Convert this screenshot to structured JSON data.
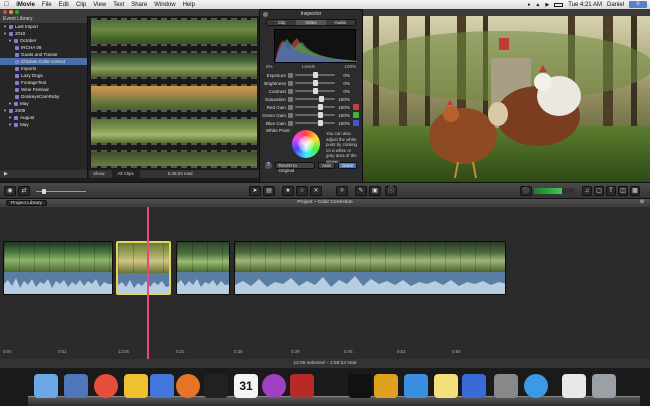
{
  "menubar": {
    "apple": "",
    "app_name": "iMovie",
    "items": [
      "File",
      "Edit",
      "Clip",
      "View",
      "Text",
      "Share",
      "Window",
      "Help"
    ],
    "clock": "Tue 4:21 AM",
    "user": "Daniel"
  },
  "event_library": {
    "header": "Event Library",
    "items": [
      {
        "label": "Last Import",
        "level": 0,
        "selected": false
      },
      {
        "label": "2010",
        "level": 0,
        "selected": false
      },
      {
        "label": "October",
        "level": 1,
        "selected": false
      },
      {
        "label": "IRCHA 08",
        "level": 2,
        "selected": false
      },
      {
        "label": "Goats and Tractor",
        "level": 2,
        "selected": false
      },
      {
        "label": "Chicken Color correct",
        "level": 2,
        "selected": true
      },
      {
        "label": "Imports",
        "level": 2,
        "selected": false
      },
      {
        "label": "Lazy Dogs",
        "level": 2,
        "selected": false
      },
      {
        "label": "FootageText",
        "level": 2,
        "selected": false
      },
      {
        "label": "Wine Festival",
        "level": 2,
        "selected": false
      },
      {
        "label": "DonkeysCamRuby",
        "level": 2,
        "selected": false
      },
      {
        "label": "May",
        "level": 1,
        "selected": false
      },
      {
        "label": "2009",
        "level": 0,
        "selected": false
      },
      {
        "label": "August",
        "level": 1,
        "selected": false
      },
      {
        "label": "May",
        "level": 1,
        "selected": false
      }
    ]
  },
  "event_browser": {
    "show_label": "Show:",
    "show_value": "All Clips",
    "total": "5:36:53 total"
  },
  "inspector": {
    "title": "Inspector",
    "tabs": [
      {
        "label": "Clip",
        "active": false
      },
      {
        "label": "Video",
        "active": true
      },
      {
        "label": "Audio",
        "active": false
      }
    ],
    "levels_label": "Levels",
    "levels_min": "0%",
    "levels_max": "100%",
    "sliders": [
      {
        "label": "Exposure",
        "value": "0%",
        "pos": 0.5
      },
      {
        "label": "Brightness",
        "value": "0%",
        "pos": 0.5
      },
      {
        "label": "Contrast",
        "value": "0%",
        "pos": 0.5
      },
      {
        "label": "Saturation",
        "value": "100%",
        "pos": 0.68
      },
      {
        "label": "Red Gain",
        "value": "100%",
        "pos": 0.65,
        "color": "#d23a3a"
      },
      {
        "label": "Green Gain",
        "value": "100%",
        "pos": 0.65,
        "color": "#3ab43a"
      },
      {
        "label": "Blue Gain",
        "value": "100%",
        "pos": 0.65,
        "color": "#3a5ad2"
      }
    ],
    "white_point_label": "White Point:",
    "white_point_help": "You can also adjust the white point by clicking on a white or gray area of the viewer.",
    "revert_button": "Revert to Original",
    "auto_button": "Auto",
    "done_button": "Done",
    "help_button": "?"
  },
  "project": {
    "library_button": "Project Library",
    "title": "Project – Color Correction",
    "ruler": [
      "0:00",
      "0:02",
      "12:05",
      "0:21",
      "0:35",
      "0:39",
      "0:45",
      "0:52",
      "0:58"
    ],
    "status": "12:05 selected – 1:58:24 total"
  },
  "clips": [
    {
      "name": "clip-1",
      "selected": false
    },
    {
      "name": "clip-2",
      "selected": true
    },
    {
      "name": "clip-3",
      "selected": false
    },
    {
      "name": "clip-4",
      "selected": false
    }
  ],
  "dock": {
    "icons": [
      "finder-icon",
      "preview-icon",
      "chrome-icon",
      "imovie-icon",
      "dashboard-icon",
      "firefox-icon",
      "clapper-icon",
      "calendar-icon",
      "itunes-disc-icon",
      "rocket-icon",
      "terminal-icon",
      "pencil-icon",
      "itunes-icon",
      "stickies-icon",
      "quicktime-icon",
      "preferences-icon",
      "safari-icon",
      "documents-icon",
      "trash-icon"
    ],
    "calendar_day": "31"
  }
}
